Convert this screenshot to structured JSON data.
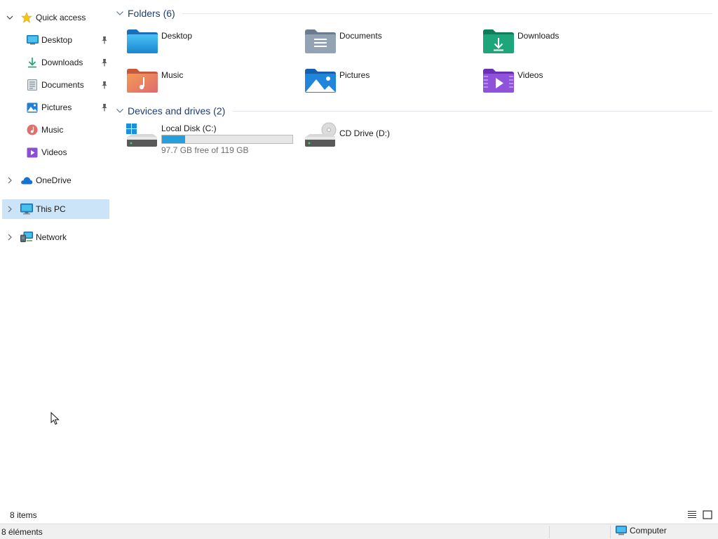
{
  "sidebar": {
    "quick_access": "Quick access",
    "items": [
      {
        "label": "Desktop",
        "icon": "desktop-icon",
        "pinned": true
      },
      {
        "label": "Downloads",
        "icon": "downloads-icon",
        "pinned": true
      },
      {
        "label": "Documents",
        "icon": "documents-icon",
        "pinned": true
      },
      {
        "label": "Pictures",
        "icon": "pictures-icon",
        "pinned": true
      },
      {
        "label": "Music",
        "icon": "music-icon",
        "pinned": false
      },
      {
        "label": "Videos",
        "icon": "videos-icon",
        "pinned": false
      }
    ],
    "onedrive": "OneDrive",
    "this_pc": "This PC",
    "network": "Network"
  },
  "folders": {
    "title": "Folders (6)",
    "items": [
      {
        "label": "Desktop",
        "icon": "desktop-folder-icon"
      },
      {
        "label": "Documents",
        "icon": "documents-folder-icon"
      },
      {
        "label": "Downloads",
        "icon": "downloads-folder-icon"
      },
      {
        "label": "Music",
        "icon": "music-folder-icon"
      },
      {
        "label": "Pictures",
        "icon": "pictures-folder-icon"
      },
      {
        "label": "Videos",
        "icon": "videos-folder-icon"
      }
    ]
  },
  "drives": {
    "title": "Devices and drives (2)",
    "items": [
      {
        "label": "Local Disk (C:)",
        "free_text": "97.7 GB free of 119 GB",
        "used_fraction": 0.179
      },
      {
        "label": "CD Drive (D:)"
      }
    ]
  },
  "footer": {
    "items_count": "8 items"
  },
  "statusbar": {
    "left": "8 éléments",
    "zone": "Computer"
  },
  "colors": {
    "selection": "#cce4f7",
    "group_title": "#1e3d73",
    "drive_fill": "#26a0da"
  }
}
